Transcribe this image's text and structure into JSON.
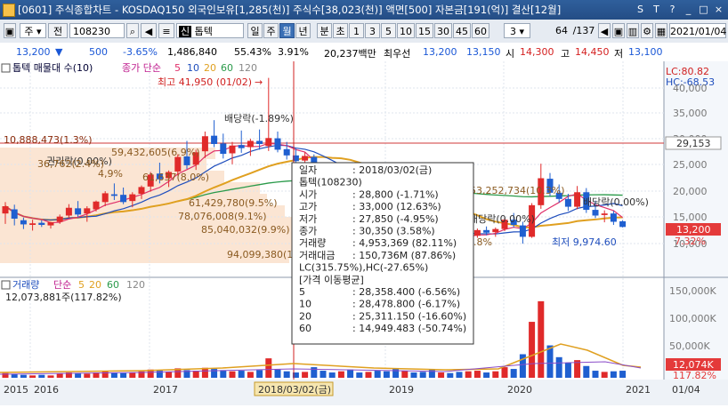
{
  "window": {
    "title": "[0601] 주식종합차트 - KOSDAQ150 외국인보유[1,285(천)] 주식수[38,023(천)] 액면[500] 자본금[191(억)] 결산[12월]",
    "buttons": [
      "S",
      "T",
      "?",
      "_",
      "□",
      "×"
    ]
  },
  "toolbar": {
    "market": "주",
    "market2": "전",
    "code": "108230",
    "stock_name": "톱텍",
    "periods": [
      "일",
      "주",
      "월",
      "년"
    ],
    "selected_period": "월",
    "minute_labels": [
      "분",
      "초",
      "1",
      "3",
      "5",
      "10",
      "15",
      "30",
      "45",
      "60"
    ],
    "count_select": "3",
    "page": "64",
    "page_total": "/137",
    "date": "2021/01/04"
  },
  "quote": {
    "price": "13,200",
    "change": "500",
    "change_pct": "-3.65%",
    "volume": "1,486,840",
    "vol_ratio": "55.43%",
    "turnover": "3.91%",
    "amount": "20,237백만",
    "best_ask_label": "최우선",
    "best_ask": "13,200",
    "best_bid": "13,150",
    "open_label": "시",
    "open": "14,300",
    "high_label": "고",
    "high": "14,450",
    "low_label": "저",
    "low": "13,100"
  },
  "price_panel": {
    "legend_title": "톱텍 매물대 수(10)",
    "ma_label": "종가 단순",
    "ma_periods": [
      "5",
      "10",
      "20",
      "60",
      "120"
    ],
    "lc_label": "LC:80.82",
    "hc_label": "HC:-68.53",
    "high_marker": "최고 41,950 (01/02)",
    "low_marker": "최저 9,974.60",
    "dividend_1": "배당락(-1.89%)",
    "dividend_2": "배당락(0.00%)",
    "dividend_3": "배당락(0.00%)",
    "dividend_4": "배당락(0.00%)",
    "dividend_5": "권리락(0.00%)",
    "current_price_tag": "13,200",
    "current_pct_tag": "7.32%",
    "hline_tag": "29,153",
    "left_marker": "10,888,473(1.3%)",
    "volume_profile": [
      "59,432,605(6.9%)",
      "61,637(8.0%)",
      "61,429,780(9.5%)",
      "78,076,008(9.1%)",
      "85,040,032(9.9%)",
      "94,099,380(10.9%)",
      "53,252,734(10.3%)",
      "3.8%"
    ],
    "left_overlap": "36,762(2.4%)",
    "right_axis": [
      "40,000",
      "35,000",
      "30,000",
      "25,000",
      "20,000",
      "15,000",
      "10,000"
    ],
    "mid_marker": "4,9%"
  },
  "tooltip": {
    "rows": [
      {
        "k": "일자",
        "v": ": 2018/03/02(금)"
      },
      {
        "k": "톱텍(108230)",
        "v": ""
      },
      {
        "k": "시가",
        "v": ": 28,800 (-1.71%)"
      },
      {
        "k": "고가",
        "v": ": 33,000 (12.63%)"
      },
      {
        "k": "저가",
        "v": ": 27,850 (-4.95%)"
      },
      {
        "k": "종가",
        "v": ": 30,350 (3.58%)"
      },
      {
        "k": "거래량",
        "v": ": 4,953,369 (82.11%)"
      },
      {
        "k": "거래대금",
        "v": ": 150,736M (87.86%)"
      },
      {
        "k": "LC(315.75%),HC(-27.65%)",
        "v": ""
      },
      {
        "k": "[가격 이동평균]",
        "v": ""
      },
      {
        "k": "5",
        "v": ": 28,358.400 (-6.56%)"
      },
      {
        "k": "10",
        "v": ": 28,478.800 (-6.17%)"
      },
      {
        "k": "20",
        "v": ": 25,311.150 (-16.60%)"
      },
      {
        "k": "60",
        "v": ": 14,949.483 (-50.74%)"
      }
    ]
  },
  "volume_panel": {
    "legend_title": "거래량",
    "ma_label": "단순",
    "ma_periods": [
      "5",
      "20",
      "60",
      "120"
    ],
    "summary": "12,073,881주(117.82%)",
    "right_axis": [
      "150,000K",
      "100,000K",
      "50,000K"
    ],
    "current_tag": "12,074K",
    "current_pct": "117.82%"
  },
  "x_axis": {
    "labels": [
      "2015",
      "2016",
      "2017",
      "2018/03/02(금)",
      "2019",
      "2020",
      "2021",
      "01/04"
    ]
  },
  "chart_data": {
    "type": "candlestick",
    "note_units": "KRW, monthly",
    "crosshair": "2018/03/02",
    "ohlc_selected": {
      "open": 28800,
      "high": 33000,
      "low": 27850,
      "close": 30350,
      "volume": 4953369
    },
    "current": {
      "price": 13200
    }
  }
}
